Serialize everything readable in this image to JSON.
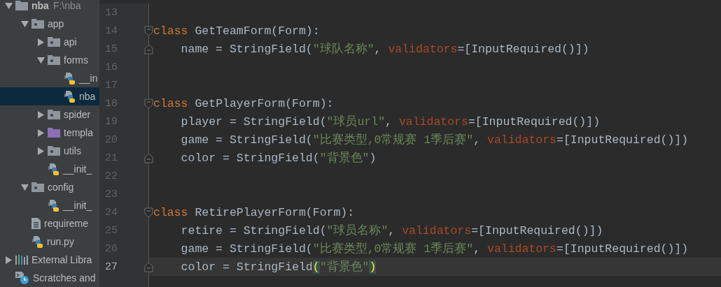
{
  "project_tree": [
    {
      "label": "nba",
      "path": "F:\\nba",
      "kind": "root-folder",
      "expanded": true,
      "selected": false,
      "children": [
        {
          "label": "app",
          "kind": "package",
          "expanded": true,
          "selected": false,
          "children": [
            {
              "label": "api",
              "kind": "package",
              "expanded": false,
              "selected": false
            },
            {
              "label": "forms",
              "kind": "package",
              "expanded": true,
              "selected": false,
              "children": [
                {
                  "label": "__in",
                  "kind": "python-file",
                  "selected": false
                },
                {
                  "label": "nba",
                  "kind": "python-file",
                  "selected": true
                }
              ]
            },
            {
              "label": "spider",
              "kind": "package",
              "expanded": false,
              "selected": false
            },
            {
              "label": "templa",
              "kind": "template-folder",
              "expanded": false,
              "selected": false
            },
            {
              "label": "utils",
              "kind": "package",
              "expanded": false,
              "selected": false
            },
            {
              "label": "__init_",
              "kind": "python-file",
              "selected": false
            }
          ]
        },
        {
          "label": "config",
          "kind": "package",
          "expanded": true,
          "selected": false,
          "children": [
            {
              "label": "__init_",
              "kind": "python-file",
              "selected": false
            }
          ]
        },
        {
          "label": "requireme",
          "kind": "text-file",
          "selected": false
        },
        {
          "label": "run.py",
          "kind": "python-file",
          "selected": false
        }
      ]
    },
    {
      "label": "External Libra",
      "kind": "libraries",
      "expanded": false,
      "selected": false
    },
    {
      "label": "Scratches and",
      "kind": "scratches",
      "selected": false
    }
  ],
  "editor": {
    "lines": [
      {
        "number": "13",
        "current": false,
        "fold_start": false,
        "fold_end": false
      },
      {
        "number": "14",
        "current": false,
        "fold_start": true,
        "fold_end": false,
        "tokens": [
          {
            "text": "class ",
            "kind": "keyword"
          },
          {
            "text": "GetTeamForm(Form):",
            "kind": "plain"
          }
        ]
      },
      {
        "number": "15",
        "current": false,
        "fold_start": false,
        "fold_end": true,
        "tokens": [
          {
            "text": "    name = StringField(",
            "kind": "plain"
          },
          {
            "text": "\"球队名称\"",
            "kind": "string"
          },
          {
            "text": ", ",
            "kind": "plain"
          },
          {
            "text": "validators",
            "kind": "param"
          },
          {
            "text": "=[InputRequired()])",
            "kind": "plain"
          }
        ]
      },
      {
        "number": "16",
        "current": false,
        "fold_start": false,
        "fold_end": false
      },
      {
        "number": "17",
        "current": false,
        "fold_start": false,
        "fold_end": false
      },
      {
        "number": "18",
        "current": false,
        "fold_start": true,
        "fold_end": false,
        "tokens": [
          {
            "text": "class ",
            "kind": "keyword"
          },
          {
            "text": "GetPlayerForm(Form):",
            "kind": "plain"
          }
        ]
      },
      {
        "number": "19",
        "current": false,
        "fold_start": false,
        "fold_end": false,
        "tokens": [
          {
            "text": "    player = StringField(",
            "kind": "plain"
          },
          {
            "text": "\"球员url\"",
            "kind": "string"
          },
          {
            "text": ", ",
            "kind": "plain"
          },
          {
            "text": "validators",
            "kind": "param"
          },
          {
            "text": "=[InputRequired()])",
            "kind": "plain"
          }
        ]
      },
      {
        "number": "20",
        "current": false,
        "fold_start": false,
        "fold_end": false,
        "tokens": [
          {
            "text": "    game = StringField(",
            "kind": "plain"
          },
          {
            "text": "\"比赛类型,0常规赛 1季后赛\"",
            "kind": "string"
          },
          {
            "text": ", ",
            "kind": "plain"
          },
          {
            "text": "validators",
            "kind": "param"
          },
          {
            "text": "=[InputRequired()])",
            "kind": "plain"
          }
        ]
      },
      {
        "number": "21",
        "current": false,
        "fold_start": false,
        "fold_end": true,
        "tokens": [
          {
            "text": "    color = StringField(",
            "kind": "plain"
          },
          {
            "text": "\"背景色\"",
            "kind": "string"
          },
          {
            "text": ")",
            "kind": "plain"
          }
        ]
      },
      {
        "number": "22",
        "current": false,
        "fold_start": false,
        "fold_end": false
      },
      {
        "number": "23",
        "current": false,
        "fold_start": false,
        "fold_end": false
      },
      {
        "number": "24",
        "current": false,
        "fold_start": true,
        "fold_end": false,
        "tokens": [
          {
            "text": "class ",
            "kind": "keyword"
          },
          {
            "text": "RetirePlayerForm(Form):",
            "kind": "plain"
          }
        ]
      },
      {
        "number": "25",
        "current": false,
        "fold_start": false,
        "fold_end": false,
        "tokens": [
          {
            "text": "    retire = StringField(",
            "kind": "plain"
          },
          {
            "text": "\"球员名称\"",
            "kind": "string"
          },
          {
            "text": ", ",
            "kind": "plain"
          },
          {
            "text": "validators",
            "kind": "param"
          },
          {
            "text": "=[InputRequired()])",
            "kind": "plain"
          }
        ]
      },
      {
        "number": "26",
        "current": false,
        "fold_start": false,
        "fold_end": false,
        "tokens": [
          {
            "text": "    game = StringField(",
            "kind": "plain"
          },
          {
            "text": "\"比赛类型,0常规赛 1季后赛\"",
            "kind": "string"
          },
          {
            "text": ", ",
            "kind": "plain"
          },
          {
            "text": "validators",
            "kind": "param"
          },
          {
            "text": "=[InputRequired()])",
            "kind": "plain"
          }
        ]
      },
      {
        "number": "27",
        "current": true,
        "fold_start": false,
        "fold_end": true,
        "tokens": [
          {
            "text": "    color = StringField",
            "kind": "plain"
          },
          {
            "text": "(",
            "kind": "bracket"
          },
          {
            "text": "\"背景色\"",
            "kind": "string"
          },
          {
            "text": ")",
            "kind": "bracket"
          }
        ]
      }
    ]
  }
}
